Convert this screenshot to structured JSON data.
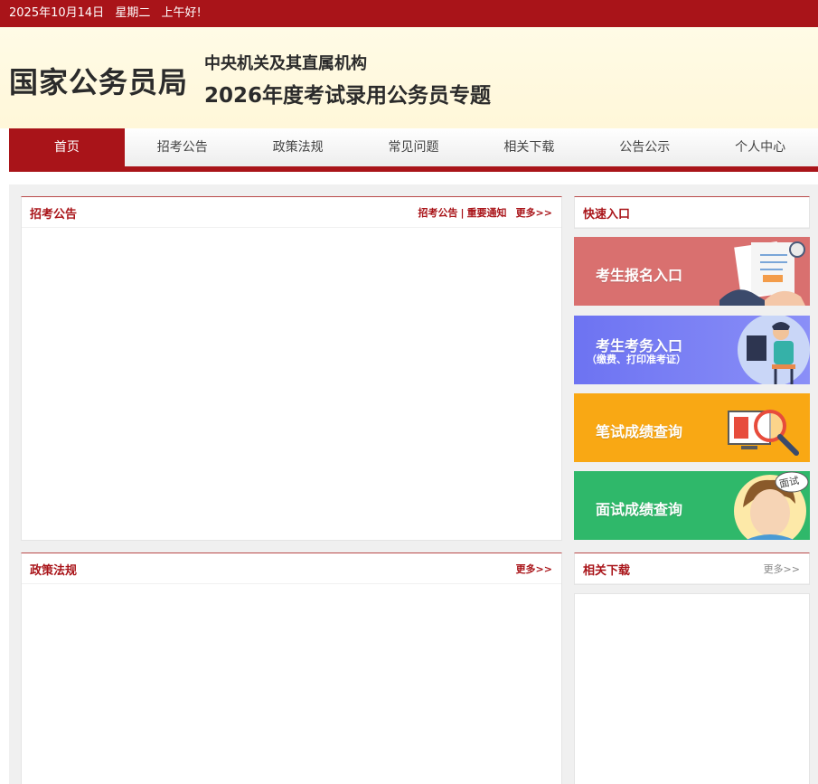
{
  "topbar": {
    "date": "2025年10月14日",
    "weekday": "星期二",
    "greeting": "上午好!"
  },
  "header": {
    "logo": "国家公务员局",
    "subtitle1": "中央机关及其直属机构",
    "subtitle2": "2026年度考试录用公务员专题"
  },
  "nav": {
    "items": [
      {
        "label": "首页"
      },
      {
        "label": "招考公告"
      },
      {
        "label": "政策法规"
      },
      {
        "label": "常见问题"
      },
      {
        "label": "相关下载"
      },
      {
        "label": "公告公示"
      },
      {
        "label": "个人中心"
      }
    ]
  },
  "panels": {
    "recruit": {
      "title": "招考公告",
      "link1": "招考公告",
      "sep": "|",
      "link2": "重要通知",
      "more": "更多>>"
    },
    "policy": {
      "title": "政策法规",
      "more": "更多>>"
    },
    "quick": {
      "title": "快速入口"
    },
    "downloads": {
      "title": "相关下载",
      "more": "更多>>"
    }
  },
  "quick_entries": [
    {
      "label": "考生报名入口",
      "color": "#d9706f"
    },
    {
      "label": "考生考务入口",
      "sublabel": "（缴费、打印准考证）",
      "color": "#7a7ef5"
    },
    {
      "label": "笔试成绩查询",
      "color": "#f9a814"
    },
    {
      "label": "面试成绩查询",
      "badge": "面试",
      "color": "#2fb86a"
    }
  ]
}
